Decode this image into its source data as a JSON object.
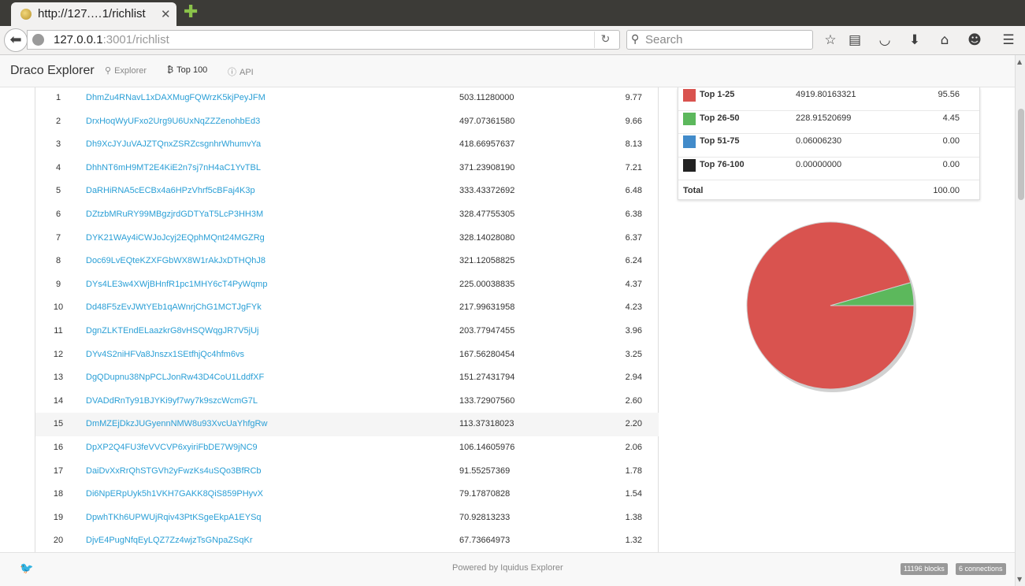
{
  "browser": {
    "tab_title": "http://127.…1/richlist",
    "url_host": "127.0.0.1",
    "url_rest": ":3001/richlist",
    "search_placeholder": "Search"
  },
  "nav": {
    "brand": "Draco Explorer",
    "links": [
      {
        "label": "Explorer",
        "icon": "search-icon"
      },
      {
        "label": "Top 100",
        "icon": "bitcoin-icon"
      },
      {
        "label": "API",
        "icon": "info-icon"
      }
    ]
  },
  "richlist": {
    "rows": [
      {
        "rank": "1",
        "address": "DhmZu4RNavL1xDAXMugFQWrzK5kjPeyJFM",
        "balance": "503.11280000",
        "percent": "9.77"
      },
      {
        "rank": "2",
        "address": "DrxHoqWyUFxo2Urg9U6UxNqZZZenohbEd3",
        "balance": "497.07361580",
        "percent": "9.66"
      },
      {
        "rank": "3",
        "address": "Dh9XcJYJuVAJZTQnxZSRZcsgnhrWhumvYa",
        "balance": "418.66957637",
        "percent": "8.13"
      },
      {
        "rank": "4",
        "address": "DhhNT6mH9MT2E4KiE2n7sj7nH4aC1YvTBL",
        "balance": "371.23908190",
        "percent": "7.21"
      },
      {
        "rank": "5",
        "address": "DaRHiRNA5cECBx4a6HPzVhrf5cBFaj4K3p",
        "balance": "333.43372692",
        "percent": "6.48"
      },
      {
        "rank": "6",
        "address": "DZtzbMRuRY99MBgzjrdGDTYaT5LcP3HH3M",
        "balance": "328.47755305",
        "percent": "6.38"
      },
      {
        "rank": "7",
        "address": "DYK21WAy4iCWJoJcyj2EQphMQnt24MGZRg",
        "balance": "328.14028080",
        "percent": "6.37"
      },
      {
        "rank": "8",
        "address": "Doc69LvEQteKZXFGbWX8W1rAkJxDTHQhJ8",
        "balance": "321.12058825",
        "percent": "6.24"
      },
      {
        "rank": "9",
        "address": "DYs4LE3w4XWjBHnfR1pc1MHY6cT4PyWqmp",
        "balance": "225.00038835",
        "percent": "4.37"
      },
      {
        "rank": "10",
        "address": "Dd48F5zEvJWtYEb1qAWnrjChG1MCTJgFYk",
        "balance": "217.99631958",
        "percent": "4.23"
      },
      {
        "rank": "11",
        "address": "DgnZLKTEndELaazkrG8vHSQWqgJR7V5jUj",
        "balance": "203.77947455",
        "percent": "3.96"
      },
      {
        "rank": "12",
        "address": "DYv4S2niHFVa8Jnszx1SEtfhjQc4hfm6vs",
        "balance": "167.56280454",
        "percent": "3.25"
      },
      {
        "rank": "13",
        "address": "DgQDupnu38NpPCLJonRw43D4CoU1LddfXF",
        "balance": "151.27431794",
        "percent": "2.94"
      },
      {
        "rank": "14",
        "address": "DVADdRnTy91BJYKi9yf7wy7k9szcWcmG7L",
        "balance": "133.72907560",
        "percent": "2.60"
      },
      {
        "rank": "15",
        "address": "DmMZEjDkzJUGyennNMW8u93XvcUaYhfgRw",
        "balance": "113.37318023",
        "percent": "2.20"
      },
      {
        "rank": "16",
        "address": "DpXP2Q4FU3feVVCVP6xyiriFbDE7W9jNC9",
        "balance": "106.14605976",
        "percent": "2.06"
      },
      {
        "rank": "17",
        "address": "DaiDvXxRrQhSTGVh2yFwzKs4uSQo3BfRCb",
        "balance": "91.55257369",
        "percent": "1.78"
      },
      {
        "rank": "18",
        "address": "Di6NpERpUyk5h1VKH7GAKK8QiS859PHyvX",
        "balance": "79.17870828",
        "percent": "1.54"
      },
      {
        "rank": "19",
        "address": "DpwhTKh6UPWUjRqiv43PtKSgeEkpA1EYSq",
        "balance": "70.92813233",
        "percent": "1.38"
      },
      {
        "rank": "20",
        "address": "DjvE4PugNfqEyLQZ7Zz4wjzTsGNpaZSqKr",
        "balance": "67.73664973",
        "percent": "1.32"
      }
    ]
  },
  "summary": {
    "rows": [
      {
        "label": "Top 1-25",
        "amount": "4919.80163321",
        "percent": "95.56",
        "color": "#d9534f"
      },
      {
        "label": "Top 26-50",
        "amount": "228.91520699",
        "percent": "4.45",
        "color": "#5cb85c"
      },
      {
        "label": "Top 51-75",
        "amount": "0.06006230",
        "percent": "0.00",
        "color": "#428bca"
      },
      {
        "label": "Top 76-100",
        "amount": "0.00000000",
        "percent": "0.00",
        "color": "#222222"
      }
    ],
    "total_label": "Total",
    "total_percent": "100.00"
  },
  "chart_data": {
    "type": "pie",
    "categories": [
      "Top 1-25",
      "Top 26-50",
      "Top 51-75",
      "Top 76-100"
    ],
    "values": [
      95.56,
      4.45,
      0.0,
      0.0
    ],
    "colors": [
      "#d9534f",
      "#5cb85c",
      "#428bca",
      "#222222"
    ]
  },
  "footer": {
    "powered": "Powered by Iquidus Explorer",
    "blocks_badge": "11196 blocks",
    "connections_badge": "6 connections"
  }
}
